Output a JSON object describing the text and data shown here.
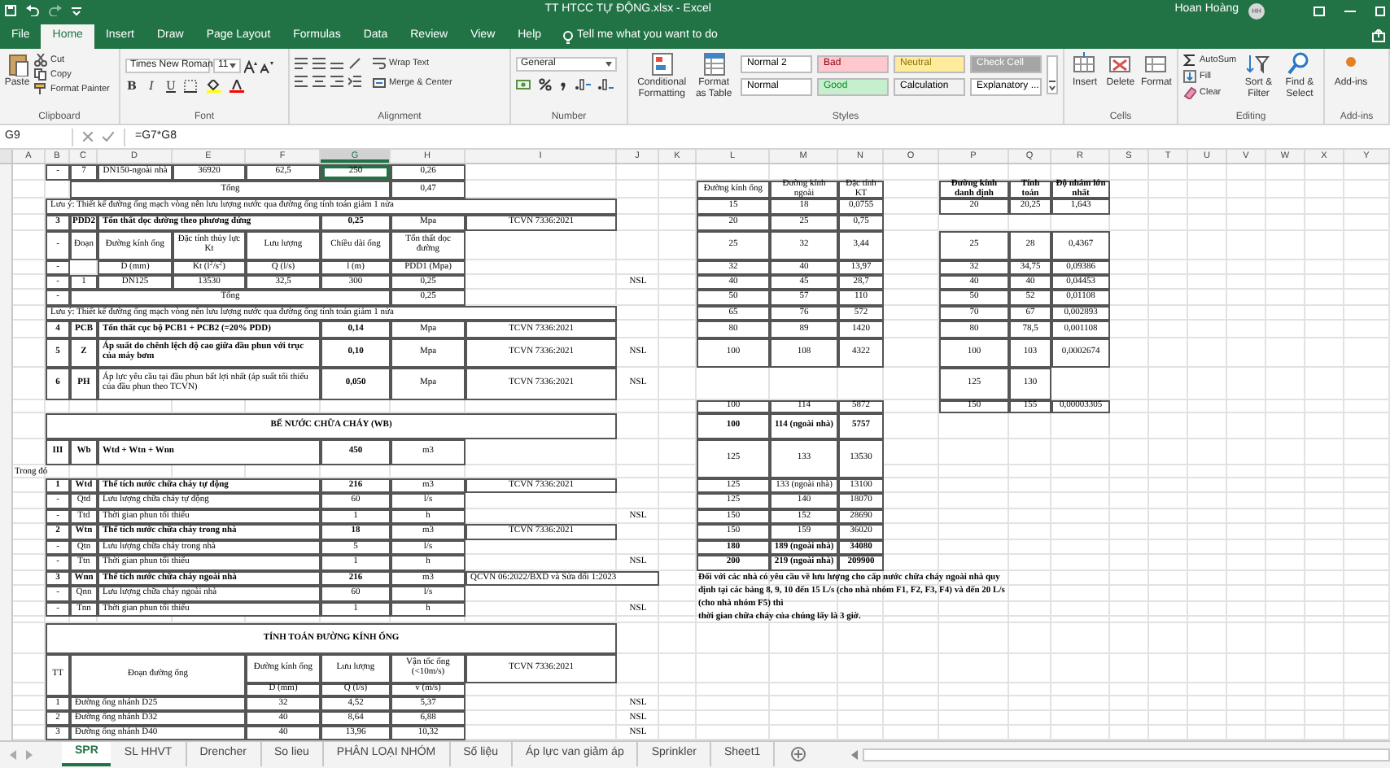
{
  "window": {
    "title": "TT HTCC TỰ ĐỘNG.xlsx  -  Excel",
    "user": "Hoan Hoàng",
    "avatar_initials": "HH"
  },
  "ribbon_tabs": [
    {
      "label": "File",
      "selected": false
    },
    {
      "label": "Home",
      "selected": true
    },
    {
      "label": "Insert",
      "selected": false
    },
    {
      "label": "Draw",
      "selected": false
    },
    {
      "label": "Page Layout",
      "selected": false
    },
    {
      "label": "Formulas",
      "selected": false
    },
    {
      "label": "Data",
      "selected": false
    },
    {
      "label": "Review",
      "selected": false
    },
    {
      "label": "View",
      "selected": false
    },
    {
      "label": "Help",
      "selected": false
    }
  ],
  "tell_me": "Tell me what you want to do",
  "ribbon_groups": [
    {
      "kind": "clipboard",
      "label": "Clipboard",
      "buttons": [
        "Paste",
        "Cut",
        "Copy",
        "Format Painter"
      ]
    },
    {
      "kind": "font",
      "label": "Font",
      "font_name": "Times New Roman",
      "font_size": "11",
      "buttons": [
        "B",
        "I",
        "U"
      ]
    },
    {
      "kind": "alignment",
      "label": "Alignment",
      "buttons": [
        "Wrap Text",
        "Merge & Center"
      ]
    },
    {
      "kind": "number",
      "label": "Number",
      "format": "General"
    },
    {
      "kind": "styles",
      "label": "Styles",
      "buttons": [
        "Conditional Formatting",
        "Format as Table"
      ],
      "styles": [
        {
          "label": "Normal 2",
          "color": "#ffffff"
        },
        {
          "label": "Normal",
          "color": "#ffffff"
        },
        {
          "label": "Bad",
          "color": "#ffc7ce"
        },
        {
          "label": "Good",
          "color": "#c6efce"
        },
        {
          "label": "Neutral",
          "color": "#ffeb9c"
        },
        {
          "label": "Calculation",
          "color": "#f2f2f2"
        },
        {
          "label": "Check Cell",
          "color": "#a5a5a5"
        },
        {
          "label": "Explanatory ...",
          "color": "#ffffff"
        }
      ]
    },
    {
      "kind": "cells",
      "label": "Cells",
      "buttons": [
        "Insert",
        "Delete",
        "Format"
      ]
    },
    {
      "kind": "editing",
      "label": "Editing",
      "buttons": [
        "AutoSum",
        "Fill",
        "Clear",
        "Sort & Filter",
        "Find & Select"
      ]
    },
    {
      "kind": "addins",
      "label": "Add-ins",
      "buttons": [
        "Add-ins"
      ]
    }
  ],
  "formula_bar": {
    "name_box": "G9",
    "formula": "=G7*G8"
  },
  "sheet": {
    "columns": [
      "A",
      "B",
      "C",
      "D",
      "E",
      "F",
      "G",
      "H",
      "I",
      "J",
      "K",
      "L",
      "M",
      "N",
      "O",
      "P",
      "Q",
      "R",
      "S",
      "T",
      "U",
      "V",
      "W",
      "X",
      "Y"
    ],
    "rows": [
      {
        "B": {
          "kind": "value",
          "text": "-"
        },
        "C": {
          "kind": "value",
          "text": "7"
        },
        "D": {
          "kind": "value",
          "text": "DN150-ngoài nhà"
        },
        "E": {
          "kind": "value",
          "text": "36920"
        },
        "F": {
          "kind": "value",
          "text": "62,5"
        },
        "G": {
          "kind": "value",
          "text": "250",
          "selected": true
        },
        "H": {
          "kind": "value",
          "text": "0,26"
        }
      },
      {
        "C": {
          "kind": "value",
          "text": "Tổng"
        },
        "H": {
          "kind": "value",
          "text": "0,47"
        },
        "L": {
          "kind": "value",
          "text": "Đường kính ống"
        },
        "M": {
          "kind": "value",
          "text": "Đường kính ngoài"
        },
        "N": {
          "kind": "value",
          "text": "Đặc tính KT"
        },
        "P": {
          "kind": "value",
          "text": "Đường kính danh định",
          "bold": true
        },
        "Q": {
          "kind": "value",
          "text": "Tính toán",
          "bold": true
        },
        "R": {
          "kind": "value",
          "text": "Độ nhám lớn nhất",
          "bold": true
        }
      },
      {
        "B": {
          "kind": "text",
          "text": "Lưu ý: Thiết kế đường ống mạch vòng nên lưu lượng nước qua đường ống tính toán giảm 1 nửa"
        },
        "L": {
          "kind": "value",
          "text": "15"
        },
        "M": {
          "kind": "value",
          "text": "18"
        },
        "N": {
          "kind": "value",
          "text": "0,0755"
        },
        "P": {
          "kind": "value",
          "text": "20"
        },
        "Q": {
          "kind": "value",
          "text": "20,25"
        },
        "R": {
          "kind": "value",
          "text": "1,643"
        }
      },
      {
        "B": {
          "kind": "value",
          "text": "3",
          "bold": true
        },
        "C": {
          "kind": "value",
          "text": "PDD2",
          "bold": true
        },
        "D": {
          "kind": "text",
          "text": "Tổn thất dọc đường theo phương đứng",
          "bold": true
        },
        "G": {
          "kind": "value",
          "text": "0,25",
          "bold": true
        },
        "H": {
          "kind": "value",
          "text": "Mpa"
        },
        "I": {
          "kind": "value",
          "text": "TCVN 7336:2021"
        },
        "L": {
          "kind": "value",
          "text": "20"
        },
        "M": {
          "kind": "value",
          "text": "25"
        },
        "N": {
          "kind": "value",
          "text": "0,75"
        }
      },
      {
        "B": {
          "kind": "value",
          "text": "-"
        },
        "C": {
          "kind": "value",
          "text": "Đoạn"
        },
        "D": {
          "kind": "value",
          "text": "Đường kính ống"
        },
        "E": {
          "kind": "value",
          "text": "Đặc tính thủy lực Kt"
        },
        "F": {
          "kind": "value",
          "text": "Lưu lượng"
        },
        "G": {
          "kind": "value",
          "text": "Chiều dài ống"
        },
        "H": {
          "kind": "value",
          "text": "Tổn thất dọc đường"
        },
        "L": {
          "kind": "value",
          "text": "25"
        },
        "M": {
          "kind": "value",
          "text": "32"
        },
        "N": {
          "kind": "value",
          "text": "3,44"
        },
        "P": {
          "kind": "value",
          "text": "25"
        },
        "Q": {
          "kind": "value",
          "text": "28"
        },
        "R": {
          "kind": "value",
          "text": "0,4367"
        }
      },
      {
        "B": {
          "kind": "value",
          "text": "-"
        },
        "D": {
          "kind": "value",
          "text": "D (mm)"
        },
        "E": {
          "kind": "value",
          "text": "Kt (l$^{2}$/s$^{2}$)"
        },
        "F": {
          "kind": "value",
          "text": "Q (l/s)"
        },
        "G": {
          "kind": "value",
          "text": "l (m)"
        },
        "H": {
          "kind": "value",
          "text": "PDD1 (Mpa)"
        },
        "L": {
          "kind": "value",
          "text": "32"
        },
        "M": {
          "kind": "value",
          "text": "40"
        },
        "N": {
          "kind": "value",
          "text": "13,97"
        },
        "P": {
          "kind": "value",
          "text": "32"
        },
        "Q": {
          "kind": "value",
          "text": "34,75"
        },
        "R": {
          "kind": "value",
          "text": "0,09386"
        }
      },
      {
        "B": {
          "kind": "value",
          "text": "-"
        },
        "C": {
          "kind": "value",
          "text": "1"
        },
        "D": {
          "kind": "value",
          "text": "DN125"
        },
        "E": {
          "kind": "value",
          "text": "13530"
        },
        "F": {
          "kind": "value",
          "text": "32,5"
        },
        "G": {
          "kind": "value",
          "text": "300"
        },
        "H": {
          "kind": "value",
          "text": "0,25"
        },
        "J": {
          "kind": "loose",
          "text": "NSL"
        },
        "L": {
          "kind": "value",
          "text": "40"
        },
        "M": {
          "kind": "value",
          "text": "45"
        },
        "N": {
          "kind": "value",
          "text": "28,7"
        },
        "P": {
          "kind": "value",
          "text": "40"
        },
        "Q": {
          "kind": "value",
          "text": "40"
        },
        "R": {
          "kind": "value",
          "text": "0,04453"
        }
      },
      {
        "B": {
          "kind": "value",
          "text": "-"
        },
        "C": {
          "kind": "value",
          "text": "Tổng"
        },
        "H": {
          "kind": "value",
          "text": "0,25"
        },
        "L": {
          "kind": "value",
          "text": "50"
        },
        "M": {
          "kind": "value",
          "text": "57"
        },
        "N": {
          "kind": "value",
          "text": "110"
        },
        "P": {
          "kind": "value",
          "text": "50"
        },
        "Q": {
          "kind": "value",
          "text": "52"
        },
        "R": {
          "kind": "value",
          "text": "0,01108"
        }
      },
      {
        "B": {
          "kind": "text",
          "text": "Lưu ý: Thiết kế đường ống mạch vòng nên lưu lượng nước qua đường ống tính toán giảm 1 nửa"
        },
        "L": {
          "kind": "value",
          "text": "65"
        },
        "M": {
          "kind": "value",
          "text": "76"
        },
        "N": {
          "kind": "value",
          "text": "572"
        },
        "P": {
          "kind": "value",
          "text": "70"
        },
        "Q": {
          "kind": "value",
          "text": "67"
        },
        "R": {
          "kind": "value",
          "text": "0,002893"
        }
      },
      {
        "B": {
          "kind": "value",
          "text": "4",
          "bold": true
        },
        "C": {
          "kind": "value",
          "text": "PCB",
          "bold": true
        },
        "D": {
          "kind": "text",
          "text": "Tổn thất cục bộ PCB1 + PCB2 (=20% PDD)",
          "bold": true
        },
        "G": {
          "kind": "value",
          "text": "0,14",
          "bold": true
        },
        "H": {
          "kind": "value",
          "text": "Mpa"
        },
        "I": {
          "kind": "value",
          "text": "TCVN 7336:2021"
        },
        "L": {
          "kind": "value",
          "text": "80"
        },
        "M": {
          "kind": "value",
          "text": "89"
        },
        "N": {
          "kind": "value",
          "text": "1420"
        },
        "P": {
          "kind": "value",
          "text": "80"
        },
        "Q": {
          "kind": "value",
          "text": "78,5"
        },
        "R": {
          "kind": "value",
          "text": "0,001108"
        }
      },
      {
        "B": {
          "kind": "value",
          "text": "5",
          "bold": true
        },
        "C": {
          "kind": "value",
          "text": "Z",
          "bold": true
        },
        "D": {
          "kind": "text",
          "text": "Áp suất do chênh lệch độ cao giữa đầu phun với trục của máy bơm",
          "bold": true
        },
        "G": {
          "kind": "value",
          "text": "0,10",
          "bold": true
        },
        "H": {
          "kind": "value",
          "text": "Mpa"
        },
        "I": {
          "kind": "value",
          "text": "TCVN 7336:2021"
        },
        "J": {
          "kind": "loose",
          "text": "NSL"
        },
        "L": {
          "kind": "value",
          "text": "100"
        },
        "M": {
          "kind": "value",
          "text": "108"
        },
        "N": {
          "kind": "value",
          "text": "4322"
        },
        "P": {
          "kind": "value",
          "text": "100"
        },
        "Q": {
          "kind": "value",
          "text": "103"
        },
        "R": {
          "kind": "value",
          "text": "0,0002674"
        }
      },
      {
        "B": {
          "kind": "value",
          "text": "6",
          "bold": true
        },
        "C": {
          "kind": "value",
          "text": "PH",
          "bold": true
        },
        "D": {
          "kind": "text",
          "text": "Áp lực yêu cầu tại đầu phun bất lợi nhất (áp suất tối thiểu của đầu phun theo TCVN)"
        },
        "G": {
          "kind": "value",
          "text": "0,050",
          "bold": true
        },
        "H": {
          "kind": "value",
          "text": "Mpa"
        },
        "I": {
          "kind": "value",
          "text": "TCVN 7336:2021"
        },
        "J": {
          "kind": "loose",
          "text": "NSL"
        },
        "P": {
          "kind": "value",
          "text": "125"
        },
        "Q": {
          "kind": "value",
          "text": "130"
        }
      },
      {
        "L": {
          "kind": "value",
          "text": "100"
        },
        "M": {
          "kind": "value",
          "text": "114"
        },
        "N": {
          "kind": "value",
          "text": "5872"
        },
        "P": {
          "kind": "value",
          "text": "150"
        },
        "Q": {
          "kind": "value",
          "text": "155"
        },
        "R": {
          "kind": "value",
          "text": "0,00003305"
        }
      },
      {
        "B": {
          "kind": "value",
          "text": "BỂ NƯỚC CHỮA CHÁY (WB)",
          "bold": true
        },
        "L": {
          "kind": "value",
          "text": "100",
          "bold": true
        },
        "M": {
          "kind": "value",
          "text": "114 (ngoài nhà)",
          "bold": true
        },
        "N": {
          "kind": "value",
          "text": "5757",
          "bold": true
        }
      },
      {
        "B": {
          "kind": "value",
          "text": "III",
          "bold": true
        },
        "C": {
          "kind": "value",
          "text": "Wb",
          "bold": true
        },
        "D": {
          "kind": "text",
          "text": "Wtd + Wtn + Wnn",
          "bold": true
        },
        "G": {
          "kind": "value",
          "text": "450",
          "bold": true
        },
        "H": {
          "kind": "value",
          "text": "m3"
        },
        "L": {
          "kind": "value",
          "text": "125"
        },
        "M": {
          "kind": "value",
          "text": "133"
        },
        "N": {
          "kind": "value",
          "text": "13530"
        }
      },
      {
        "A": {
          "kind": "plain",
          "text": "Trong đó"
        }
      },
      {
        "B": {
          "kind": "value",
          "text": "1",
          "bold": true
        },
        "C": {
          "kind": "value",
          "text": "Wtd",
          "bold": true
        },
        "D": {
          "kind": "text",
          "text": "Thể tích nước chữa cháy tự động",
          "bold": true
        },
        "G": {
          "kind": "value",
          "text": "216",
          "bold": true
        },
        "H": {
          "kind": "value",
          "text": "m3"
        },
        "I": {
          "kind": "value",
          "text": "TCVN 7336:2021"
        },
        "L": {
          "kind": "value",
          "text": "125"
        },
        "M": {
          "kind": "value",
          "text": "133 (ngoài nhà)"
        },
        "N": {
          "kind": "value",
          "text": "13100"
        }
      },
      {
        "B": {
          "kind": "value",
          "text": "-"
        },
        "C": {
          "kind": "value",
          "text": "Qtd"
        },
        "D": {
          "kind": "text",
          "text": "Lưu lượng chữa cháy tự động"
        },
        "G": {
          "kind": "value",
          "text": "60"
        },
        "H": {
          "kind": "value",
          "text": "l/s"
        },
        "L": {
          "kind": "value",
          "text": "125"
        },
        "M": {
          "kind": "value",
          "text": "140"
        },
        "N": {
          "kind": "value",
          "text": "18070"
        }
      },
      {
        "B": {
          "kind": "value",
          "text": "-"
        },
        "C": {
          "kind": "value",
          "text": "Ttd"
        },
        "D": {
          "kind": "text",
          "text": "Thời gian phun tối thiểu"
        },
        "G": {
          "kind": "value",
          "text": "1"
        },
        "H": {
          "kind": "value",
          "text": "h"
        },
        "J": {
          "kind": "loose",
          "text": "NSL"
        },
        "L": {
          "kind": "value",
          "text": "150"
        },
        "M": {
          "kind": "value",
          "text": "152"
        },
        "N": {
          "kind": "value",
          "text": "28690"
        }
      },
      {
        "B": {
          "kind": "value",
          "text": "2",
          "bold": true
        },
        "C": {
          "kind": "value",
          "text": "Wtn",
          "bold": true
        },
        "D": {
          "kind": "text",
          "text": "Thể tích nước chữa cháy trong nhà",
          "bold": true
        },
        "G": {
          "kind": "value",
          "text": "18",
          "bold": true
        },
        "H": {
          "kind": "value",
          "text": "m3"
        },
        "I": {
          "kind": "value",
          "text": "TCVN 7336:2021"
        },
        "L": {
          "kind": "value",
          "text": "150"
        },
        "M": {
          "kind": "value",
          "text": "159"
        },
        "N": {
          "kind": "value",
          "text": "36020"
        }
      },
      {
        "B": {
          "kind": "value",
          "text": "-"
        },
        "C": {
          "kind": "value",
          "text": "Qtn"
        },
        "D": {
          "kind": "text",
          "text": "Lưu lượng chữa cháy trong nhà"
        },
        "G": {
          "kind": "value",
          "text": "5"
        },
        "H": {
          "kind": "value",
          "text": "l/s"
        },
        "L": {
          "kind": "value",
          "text": "180",
          "bold": true
        },
        "M": {
          "kind": "value",
          "text": "189 (ngoài nhà)",
          "bold": true
        },
        "N": {
          "kind": "value",
          "text": "34080",
          "bold": true
        }
      },
      {
        "B": {
          "kind": "value",
          "text": "-"
        },
        "C": {
          "kind": "value",
          "text": "Ttn"
        },
        "D": {
          "kind": "text",
          "text": "Thời gian phun tối thiểu"
        },
        "G": {
          "kind": "value",
          "text": "1"
        },
        "H": {
          "kind": "value",
          "text": "h"
        },
        "J": {
          "kind": "loose",
          "text": "NSL"
        },
        "L": {
          "kind": "value",
          "text": "200",
          "bold": true
        },
        "M": {
          "kind": "value",
          "text": "219 (ngoài nhà)",
          "bold": true
        },
        "N": {
          "kind": "value",
          "text": "209900",
          "bold": true
        }
      },
      {
        "B": {
          "kind": "value",
          "text": "3",
          "bold": true
        },
        "C": {
          "kind": "value",
          "text": "Wnn",
          "bold": true
        },
        "D": {
          "kind": "text",
          "text": "Thể tích nước chữa cháy ngoài nhà",
          "bold": true
        },
        "G": {
          "kind": "value",
          "text": "216",
          "bold": true
        },
        "H": {
          "kind": "value",
          "text": "m3"
        },
        "I": {
          "kind": "text",
          "text": "QCVN 06:2022/BXD và Sửa đổi 1:2023"
        },
        "L": {
          "kind": "plain",
          "bold": true,
          "text": "Đối với các nhà có yêu cầu về lưu lượng cho cấp nước chữa cháy ngoài nhà quy\nđịnh tại các bảng 8, 9, 10 đến 15 L/s (cho nhà nhóm F1, F2, F3, F4) và đến 20 L/s\n(cho nhà nhóm F5) thì\nthời gian chữa cháy của chúng lấy là 3 giờ."
        }
      },
      {
        "B": {
          "kind": "value",
          "text": "-"
        },
        "C": {
          "kind": "value",
          "text": "Qnn"
        },
        "D": {
          "kind": "text",
          "text": "Lưu lượng chữa cháy ngoài nhà"
        },
        "G": {
          "kind": "value",
          "text": "60"
        },
        "H": {
          "kind": "value",
          "text": "l/s"
        }
      },
      {
        "B": {
          "kind": "value",
          "text": "-"
        },
        "C": {
          "kind": "value",
          "text": "Tnn"
        },
        "D": {
          "kind": "text",
          "text": "Thời gian phun tối thiểu"
        },
        "G": {
          "kind": "value",
          "text": "1"
        },
        "H": {
          "kind": "value",
          "text": "h"
        },
        "J": {
          "kind": "loose",
          "text": "NSL"
        }
      },
      {},
      {
        "B": {
          "kind": "value",
          "text": "TÍNH TOÁN ĐƯỜNG KÍNH ỐNG",
          "bold": true
        }
      },
      {
        "B": {
          "kind": "value",
          "text": "TT"
        },
        "C": {
          "kind": "value",
          "text": "Đoạn đường ống"
        },
        "F": {
          "kind": "value",
          "text": "Đường kính ống"
        },
        "G": {
          "kind": "value",
          "text": "Lưu lượng"
        },
        "H": {
          "kind": "value",
          "text": "Vận tốc ống (<10m/s)"
        },
        "I": {
          "kind": "value",
          "text": "TCVN 7336:2021"
        }
      },
      {
        "F": {
          "kind": "value",
          "text": "D (mm)"
        },
        "G": {
          "kind": "value",
          "text": "Q (l/s)"
        },
        "H": {
          "kind": "value",
          "text": "v (m/s)"
        }
      },
      {
        "B": {
          "kind": "value",
          "text": "1"
        },
        "C": {
          "kind": "text",
          "text": "Đường ống nhánh D25"
        },
        "F": {
          "kind": "value",
          "text": "32"
        },
        "G": {
          "kind": "value",
          "text": "4,52"
        },
        "H": {
          "kind": "value",
          "text": "5,37"
        },
        "J": {
          "kind": "loose",
          "text": "NSL"
        }
      },
      {
        "B": {
          "kind": "value",
          "text": "2"
        },
        "C": {
          "kind": "text",
          "text": "Đường ống nhánh D32"
        },
        "F": {
          "kind": "value",
          "text": "40"
        },
        "G": {
          "kind": "value",
          "text": "8,64"
        },
        "H": {
          "kind": "value",
          "text": "6,88"
        },
        "J": {
          "kind": "loose",
          "text": "NSL"
        }
      },
      {
        "B": {
          "kind": "value",
          "text": "3"
        },
        "C": {
          "kind": "text",
          "text": "Đường ống nhánh D40"
        },
        "F": {
          "kind": "value",
          "text": "40"
        },
        "G": {
          "kind": "value",
          "text": "13,96"
        },
        "H": {
          "kind": "value",
          "text": "10,32"
        },
        "J": {
          "kind": "loose",
          "text": "NSL"
        }
      }
    ]
  },
  "sheet_tabs": [
    {
      "label": "SPR",
      "selected": true
    },
    {
      "label": "SL HHVT",
      "selected": false
    },
    {
      "label": "Drencher",
      "selected": false
    },
    {
      "label": "So lieu",
      "selected": false
    },
    {
      "label": "PHÂN LOẠI NHÓM",
      "selected": false
    },
    {
      "label": "Số liệu",
      "selected": false
    },
    {
      "label": "Áp lực van giảm áp",
      "selected": false
    },
    {
      "label": "Sprinkler",
      "selected": false
    },
    {
      "label": "Sheet1",
      "selected": false
    }
  ]
}
